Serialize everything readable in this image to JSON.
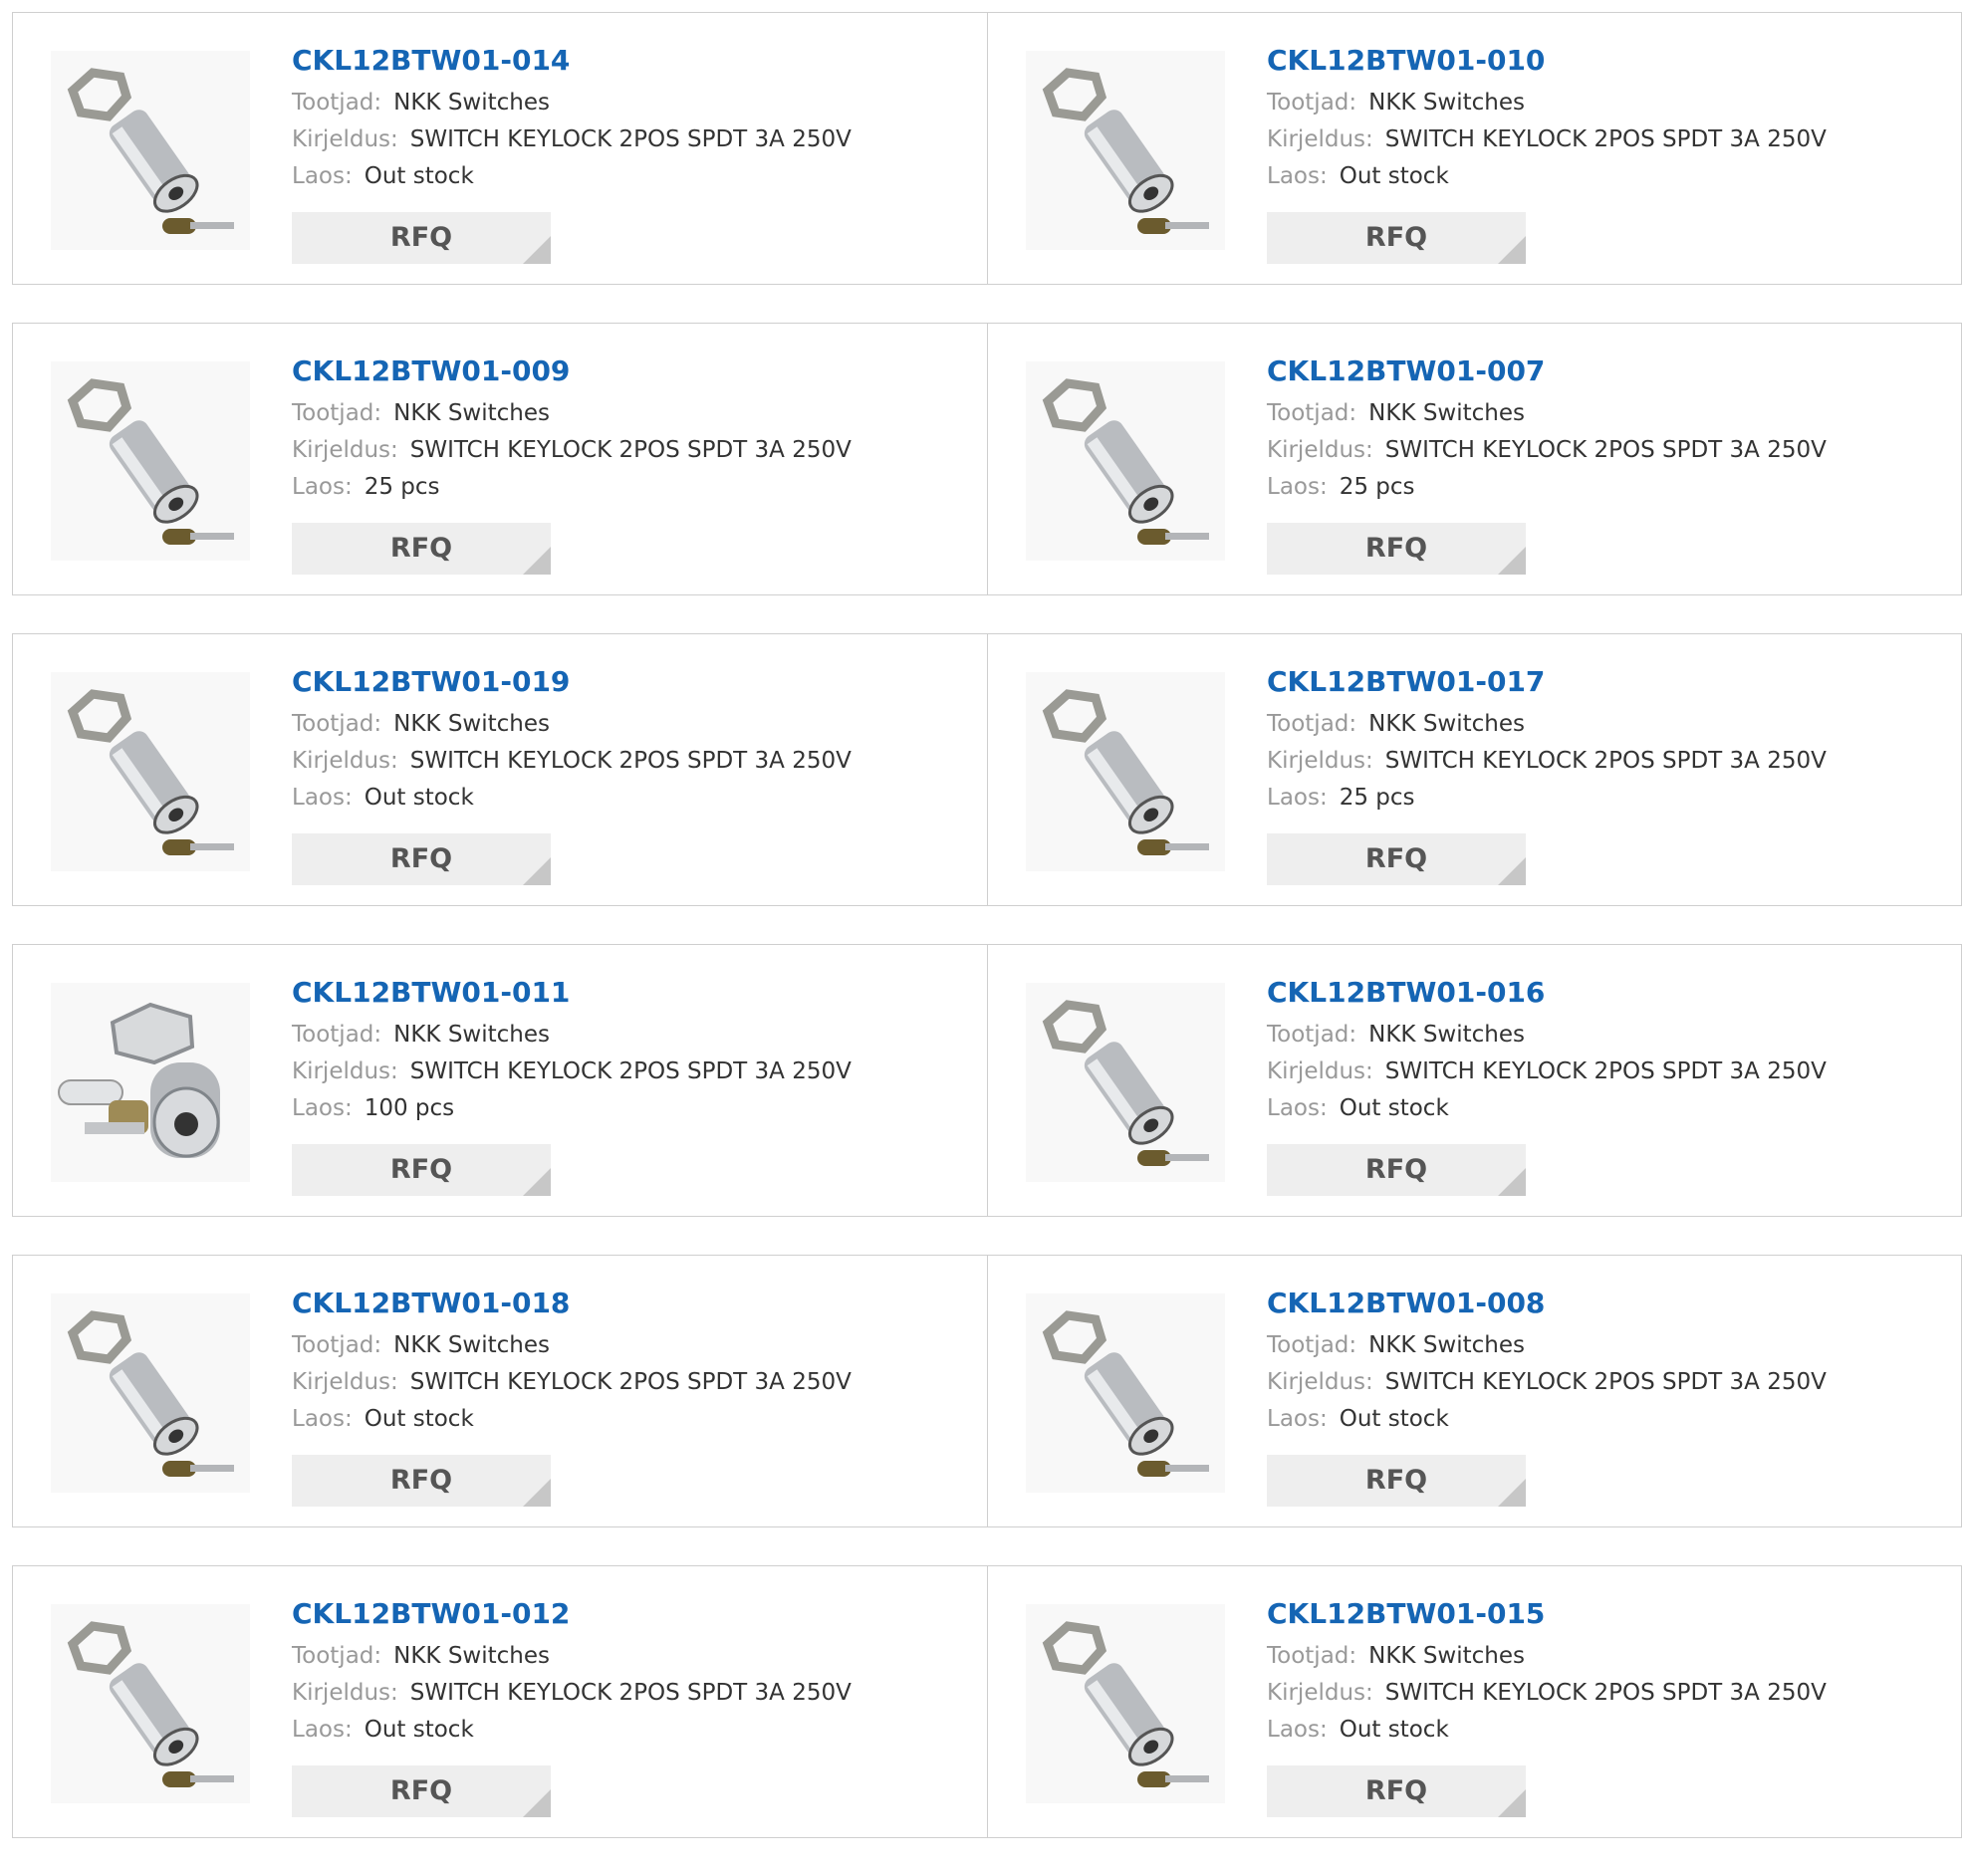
{
  "labels": {
    "manufacturer": "Tootjad:",
    "description": "Kirjeldus:",
    "stock": "Laos:",
    "rfq": "RFQ"
  },
  "products": [
    {
      "part": "CKL12BTW01-014",
      "manufacturer": "NKK Switches",
      "description": "SWITCH KEYLOCK 2POS SPDT 3A 250V",
      "stock": "Out stock",
      "image": "keylock-switch-angled"
    },
    {
      "part": "CKL12BTW01-010",
      "manufacturer": "NKK Switches",
      "description": "SWITCH KEYLOCK 2POS SPDT 3A 250V",
      "stock": "Out stock",
      "image": "keylock-switch-angled"
    },
    {
      "part": "CKL12BTW01-009",
      "manufacturer": "NKK Switches",
      "description": "SWITCH KEYLOCK 2POS SPDT 3A 250V",
      "stock": "25 pcs",
      "image": "keylock-switch-angled"
    },
    {
      "part": "CKL12BTW01-007",
      "manufacturer": "NKK Switches",
      "description": "SWITCH KEYLOCK 2POS SPDT 3A 250V",
      "stock": "25 pcs",
      "image": "keylock-switch-angled"
    },
    {
      "part": "CKL12BTW01-019",
      "manufacturer": "NKK Switches",
      "description": "SWITCH KEYLOCK 2POS SPDT 3A 250V",
      "stock": "Out stock",
      "image": "keylock-switch-angled"
    },
    {
      "part": "CKL12BTW01-017",
      "manufacturer": "NKK Switches",
      "description": "SWITCH KEYLOCK 2POS SPDT 3A 250V",
      "stock": "25 pcs",
      "image": "keylock-switch-angled"
    },
    {
      "part": "CKL12BTW01-011",
      "manufacturer": "NKK Switches",
      "description": "SWITCH KEYLOCK 2POS SPDT 3A 250V",
      "stock": "100 pcs",
      "image": "keylock-switch-front"
    },
    {
      "part": "CKL12BTW01-016",
      "manufacturer": "NKK Switches",
      "description": "SWITCH KEYLOCK 2POS SPDT 3A 250V",
      "stock": "Out stock",
      "image": "keylock-switch-angled"
    },
    {
      "part": "CKL12BTW01-018",
      "manufacturer": "NKK Switches",
      "description": "SWITCH KEYLOCK 2POS SPDT 3A 250V",
      "stock": "Out stock",
      "image": "keylock-switch-angled"
    },
    {
      "part": "CKL12BTW01-008",
      "manufacturer": "NKK Switches",
      "description": "SWITCH KEYLOCK 2POS SPDT 3A 250V",
      "stock": "Out stock",
      "image": "keylock-switch-angled"
    },
    {
      "part": "CKL12BTW01-012",
      "manufacturer": "NKK Switches",
      "description": "SWITCH KEYLOCK 2POS SPDT 3A 250V",
      "stock": "Out stock",
      "image": "keylock-switch-angled"
    },
    {
      "part": "CKL12BTW01-015",
      "manufacturer": "NKK Switches",
      "description": "SWITCH KEYLOCK 2POS SPDT 3A 250V",
      "stock": "Out stock",
      "image": "keylock-switch-angled"
    }
  ],
  "colors": {
    "part_link": "#1565b4",
    "label": "#999999",
    "value": "#333333",
    "rfq_bg": "#eeeeee",
    "border": "#cfcfcf"
  }
}
